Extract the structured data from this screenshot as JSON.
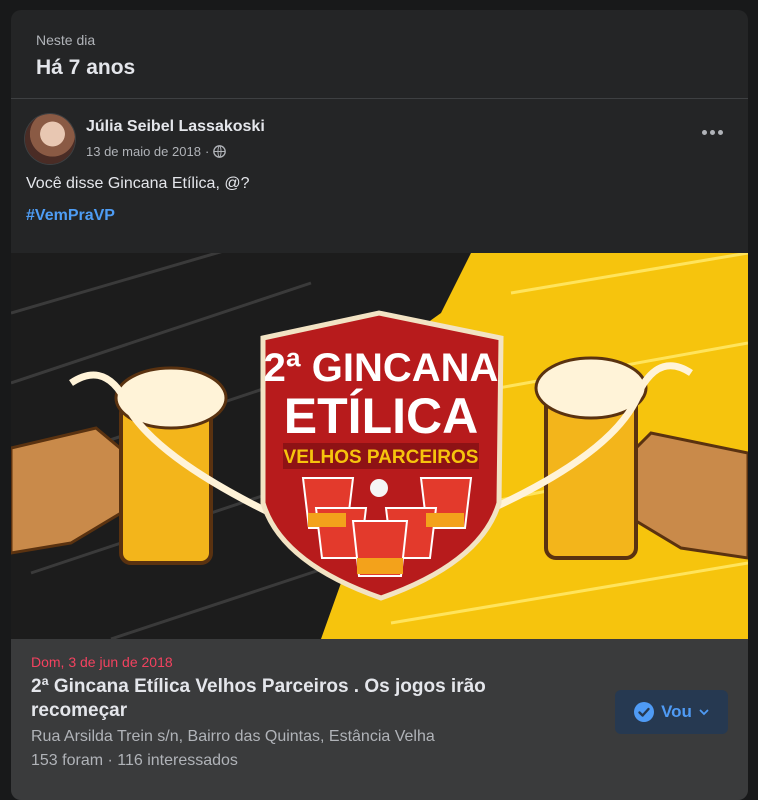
{
  "memory": {
    "subtitle": "Neste dia",
    "title": "Há 7 anos"
  },
  "post": {
    "author": "Júlia Seibel Lassakoski",
    "date": "13 de maio de 2018",
    "separator": "·",
    "text": "Você disse Gincana Etílica, @?",
    "hashtag": "#VemPraVP",
    "avatar_icon": "avatar",
    "privacy_icon": "globe-icon",
    "more_icon": "more-options-icon"
  },
  "banner": {
    "line1": "2ª GINCANA",
    "line2": "ETÍLICA",
    "line3": "VELHOS PARCEIROS"
  },
  "event": {
    "date": "Dom, 3 de jun de 2018",
    "title_line1": "2ª Gincana Etílica Velhos Parceiros . Os jogos irão",
    "title_line2": "recomeçar",
    "place": "Rua Arsilda Trein s/n, Bairro das Quintas, Estância Velha",
    "stats": "153 foram · 116 interessados",
    "going_label": "Vou",
    "going_icon": "check-circle-icon",
    "dropdown_icon": "chevron-down-icon"
  },
  "colors": {
    "card_bg": "#242526",
    "event_bg": "#3a3b3c",
    "accent_blue": "#4e9df5",
    "event_date_red": "#f3425f",
    "banner_red": "#b71b1c",
    "banner_yellow": "#f6c40d"
  }
}
